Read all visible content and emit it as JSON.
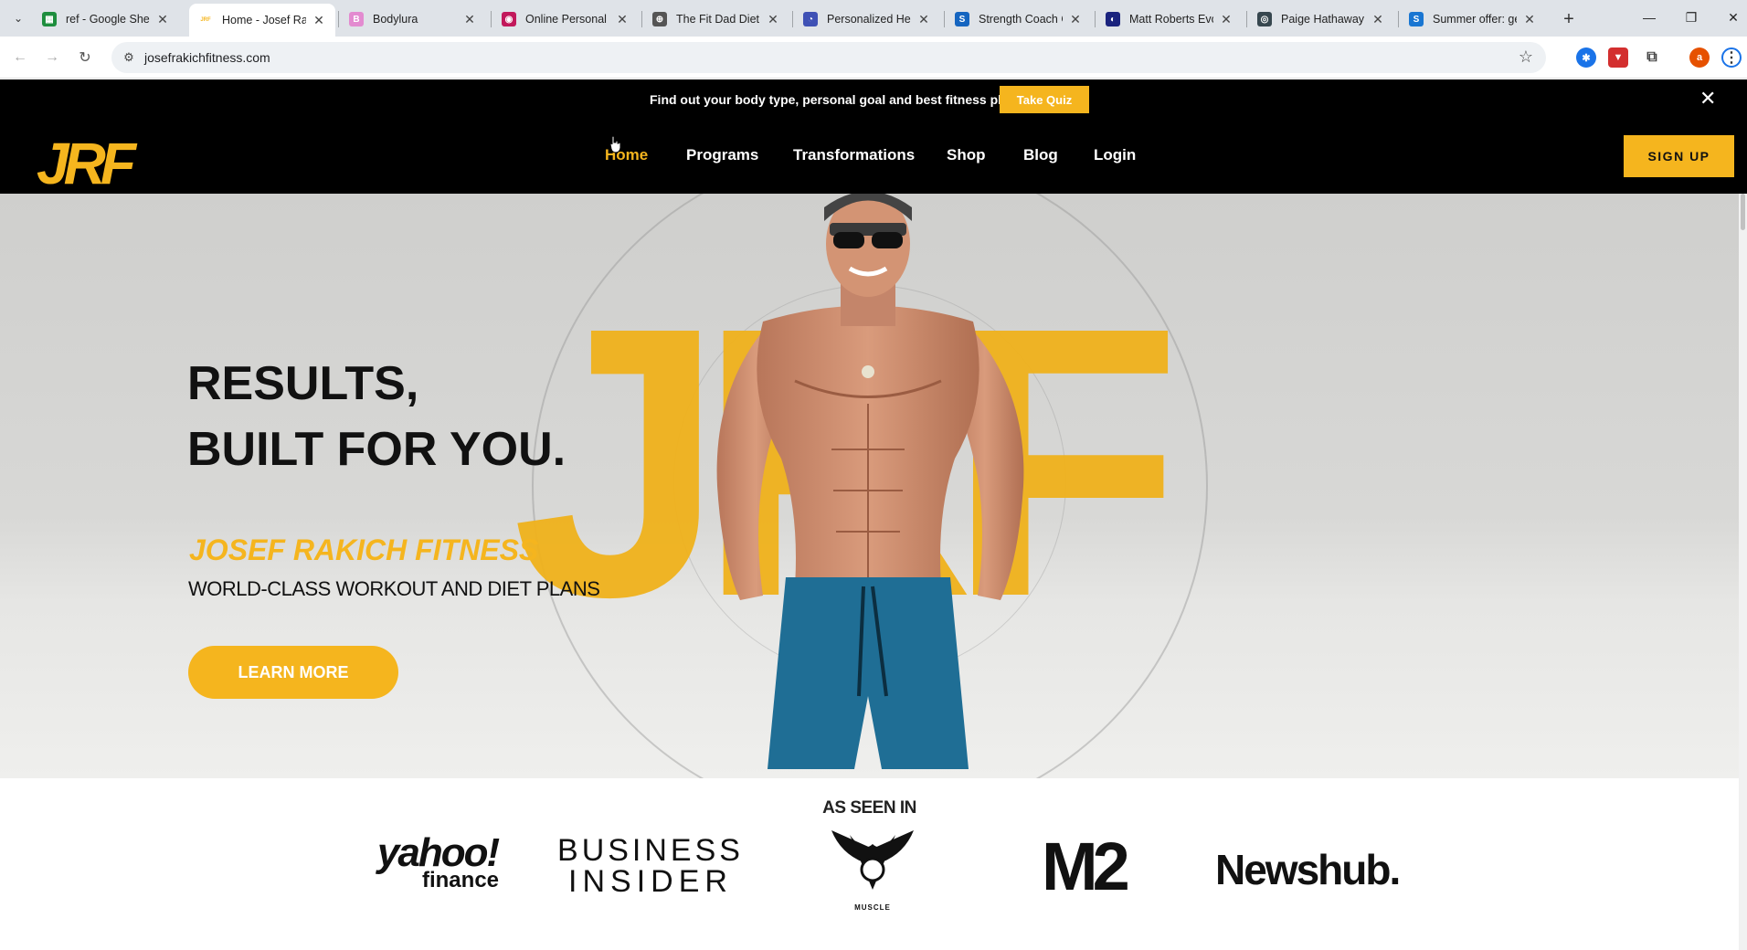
{
  "browser": {
    "tabs": [
      {
        "title": "ref - Google Shee",
        "favicon_color": "#1e8e3e",
        "favicon_glyph": "▦"
      },
      {
        "title": "Home - Josef Rak",
        "favicon_color": "#f5b51e",
        "favicon_glyph": "JRF"
      },
      {
        "title": "Bodylura",
        "favicon_color": "#e38bd0",
        "favicon_glyph": "B"
      },
      {
        "title": "Online Personal T",
        "favicon_color": "#c2185b",
        "favicon_glyph": "◉"
      },
      {
        "title": "The Fit Dad Diet:",
        "favicon_color": "#555555",
        "favicon_glyph": "⊕"
      },
      {
        "title": "Personalized Hea",
        "favicon_color": "#3f51b5",
        "favicon_glyph": "◔"
      },
      {
        "title": "Strength Coach G",
        "favicon_color": "#1565c0",
        "favicon_glyph": "S"
      },
      {
        "title": "Matt Roberts Evo",
        "favicon_color": "#1a237e",
        "favicon_glyph": "◐"
      },
      {
        "title": "Paige Hathaway",
        "favicon_color": "#37474f",
        "favicon_glyph": "◎"
      },
      {
        "title": "Summer offer: ge",
        "favicon_color": "#1976d2",
        "favicon_glyph": "S"
      }
    ],
    "url": "josefrakichfitness.com",
    "profile_initial": "a"
  },
  "announcement": {
    "message": "Find out your body type, personal goal and best fitness plan:",
    "cta": "Take Quiz"
  },
  "nav": {
    "logo": "JRF",
    "links": [
      "Home",
      "Programs",
      "Transformations",
      "Shop",
      "Blog",
      "Login"
    ],
    "active": "Home",
    "signup": "SIGN UP"
  },
  "hero": {
    "headline_line1": "RESULTS,",
    "headline_line2": "BUILT FOR YOU.",
    "brand": "JOSEF RAKICH FITNESS",
    "tagline": "WORLD-CLASS WORKOUT AND DIET PLANS",
    "cta": "LEARN MORE",
    "background_letters": "JRF"
  },
  "as_seen_in": {
    "title": "AS SEEN IN",
    "logos": [
      "yahoo! finance",
      "BUSINESS INSIDER",
      "NZ MUSCLE",
      "M2",
      "Newshub."
    ],
    "yahoo_top": "yahoo!",
    "yahoo_bottom": "finance",
    "bi_top": "BUSINESS",
    "bi_bottom": "INSIDER",
    "nzm": "MUSCLE",
    "m2": "M2",
    "newshub": "Newshub."
  },
  "colors": {
    "accent": "#f5b51e",
    "nav_bg": "#000000"
  }
}
